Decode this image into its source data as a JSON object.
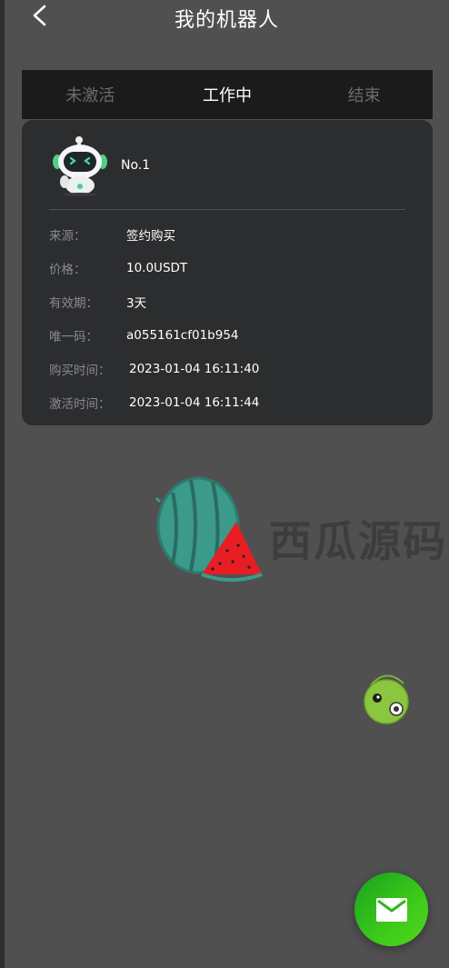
{
  "header": {
    "title": "我的机器人"
  },
  "tabs": [
    {
      "label": "未激活",
      "active": false
    },
    {
      "label": "工作中",
      "active": true
    },
    {
      "label": "结束",
      "active": false
    }
  ],
  "robot": {
    "number": "No.1",
    "fields": [
      {
        "label": "来源：",
        "value": "签约购买"
      },
      {
        "label": "价格：",
        "value": "10.0USDT"
      },
      {
        "label": "有效期：",
        "value": "3天"
      },
      {
        "label": "唯一码：",
        "value": "a055161cf01b954"
      },
      {
        "label": "购买时间：",
        "value": "2023-01-04 16:11:40"
      },
      {
        "label": "激活时间：",
        "value": "2023-01-04 16:11:44"
      }
    ]
  },
  "watermark": {
    "text": "西瓜源码"
  },
  "colors": {
    "background": "#505050",
    "card": "#2c2d2f",
    "tab_bar": "#1b1b1b",
    "fab_green": "#2fb81b",
    "label_gray": "#8a8b8e"
  },
  "icons": {
    "back": "chevron-left-icon",
    "robot": "robot-avatar-icon",
    "fab": "mail-icon",
    "watermark": "watermelon-logo-icon",
    "float": "green-ball-icon"
  }
}
